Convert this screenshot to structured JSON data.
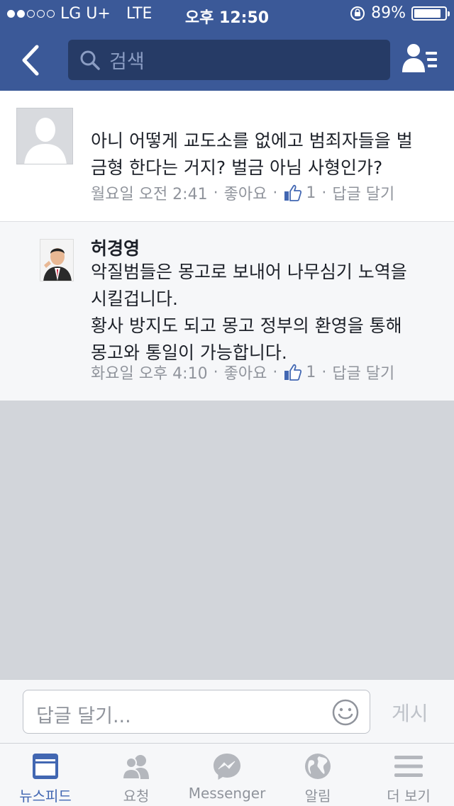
{
  "status_bar": {
    "carrier": "LG U+",
    "network": "LTE",
    "time": "오후 12:50",
    "battery": "89%",
    "battery_level": 0.89,
    "signal_bars_filled": 2,
    "signal_bars_total": 5
  },
  "header": {
    "search_placeholder": "검색"
  },
  "comment": {
    "text": "아니 어떻게 교도소를 없에고 범죄자들을 벌\n금형 한다는 거지?  벌금 아님 사형인가?",
    "time": "월요일 오전 2:41",
    "sep1": "·",
    "like_label": "좋아요",
    "sep2": "·",
    "like_count": "1",
    "sep3": "·",
    "reply_label": "답글 달기"
  },
  "reply": {
    "author": "허경영",
    "text": "악질범들은 몽고로 보내어 나무심기 노역을\n시킬겁니다.\n황사 방지도 되고 몽고 정부의 환영을 통해\n몽고와 통일이 가능합니다.",
    "time": "화요일 오후 4:10",
    "sep1": "·",
    "like_label": "좋아요",
    "sep2": "·",
    "like_count": "1",
    "sep3": "·",
    "reply_label": "답글 달기"
  },
  "composer": {
    "placeholder": "답글 달기...",
    "post_label": "게시"
  },
  "tabs": [
    {
      "label": "뉴스피드",
      "icon": "news-feed-icon",
      "active": true
    },
    {
      "label": "요청",
      "icon": "friend-requests-icon",
      "active": false
    },
    {
      "label": "Messenger",
      "icon": "messenger-icon",
      "active": false
    },
    {
      "label": "알림",
      "icon": "globe-icon",
      "active": false
    },
    {
      "label": "더 보기",
      "icon": "menu-icon",
      "active": false
    }
  ],
  "colors": {
    "brand": "#3b5998",
    "active_tab": "#4267b2",
    "muted_text": "#90949c"
  }
}
